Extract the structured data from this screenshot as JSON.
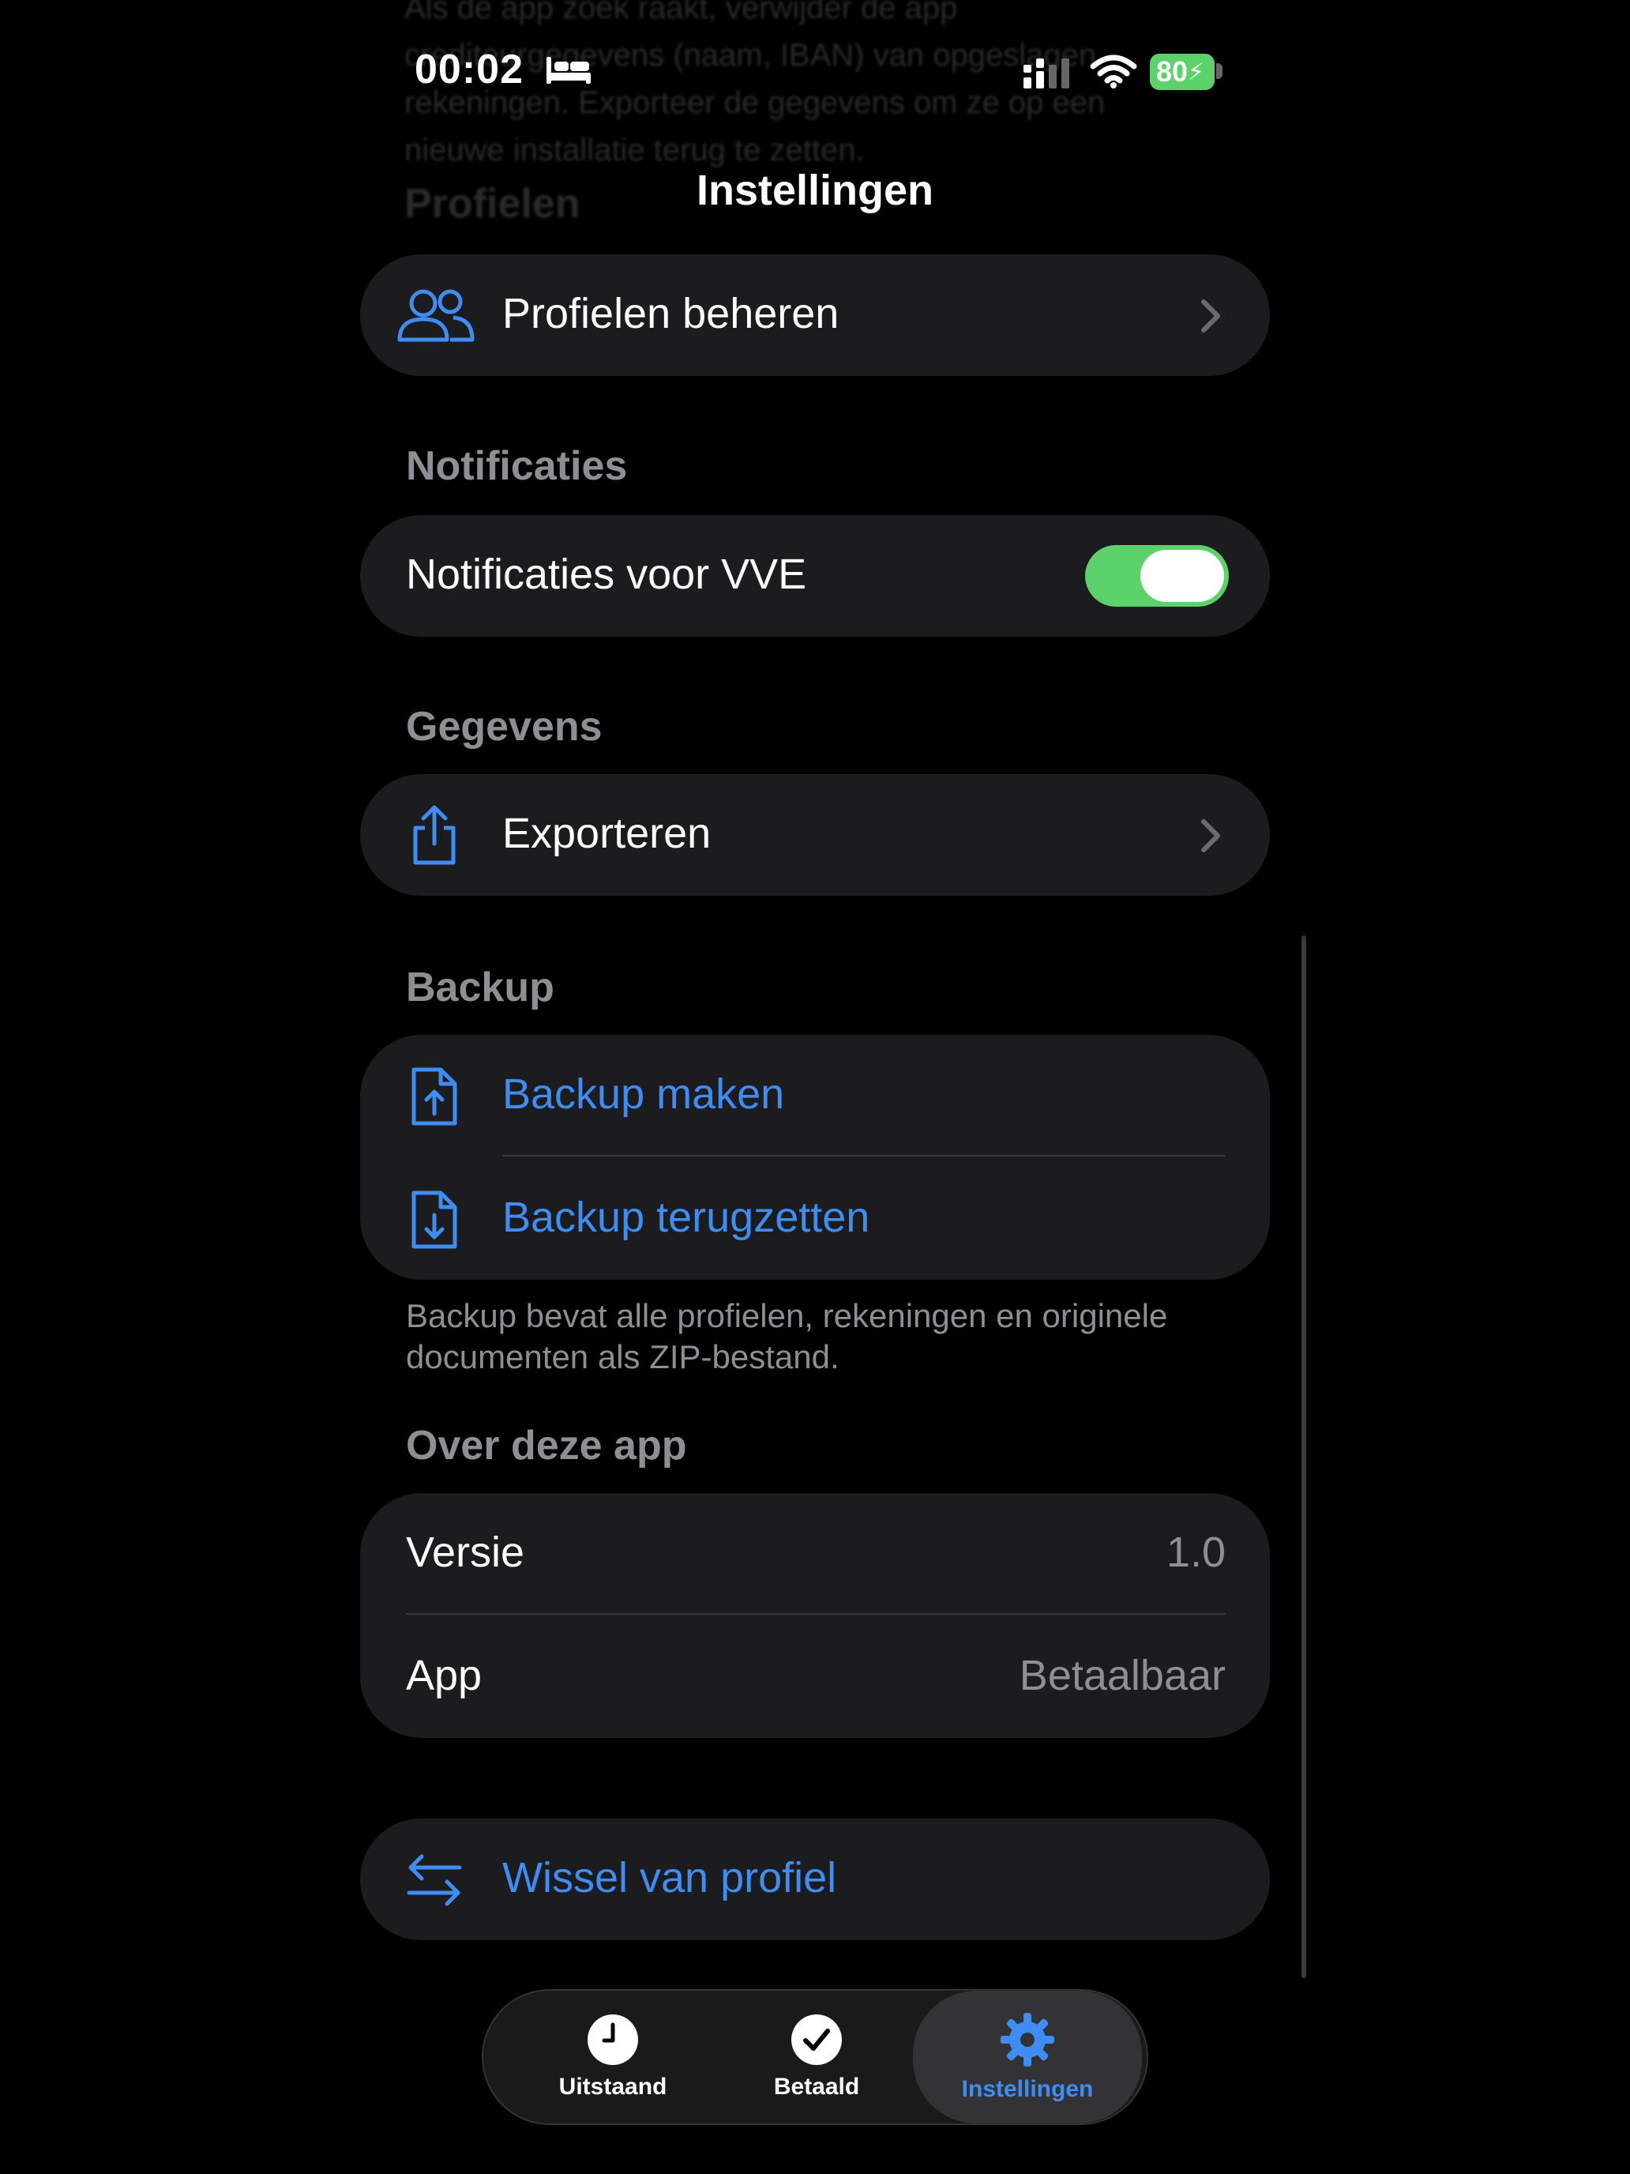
{
  "status_bar": {
    "time": "00:02",
    "battery": "80"
  },
  "background_text": {
    "lines": [
      "Als de app zoek raakt, verwijder de app",
      "crediteurgegevens (naam, IBAN) van opgeslagen",
      "rekeningen. Exporteer de gegevens om ze op een",
      "nieuwe installatie terug te zetten."
    ],
    "heading": "Profielen"
  },
  "header": {
    "title": "Instellingen"
  },
  "profiles": {
    "manage_label": "Profielen beheren"
  },
  "notifications": {
    "section_title": "Notificaties",
    "toggle_label": "Notificaties voor VVE",
    "toggle_on": true
  },
  "data": {
    "section_title": "Gegevens",
    "export_label": "Exporteren"
  },
  "backup": {
    "section_title": "Backup",
    "make_label": "Backup maken",
    "restore_label": "Backup terugzetten",
    "footnote": "Backup bevat alle profielen, rekeningen en originele documenten als ZIP-bestand."
  },
  "about": {
    "section_title": "Over deze app",
    "version_label": "Versie",
    "version_value": "1.0",
    "app_label": "App",
    "app_value": "Betaalbaar"
  },
  "switch_profile": {
    "label": "Wissel van profiel"
  },
  "tabs": [
    {
      "label": "Uitstaand",
      "icon": "clock-icon",
      "active": false
    },
    {
      "label": "Betaald",
      "icon": "checkmark-circle-icon",
      "active": false
    },
    {
      "label": "Instellingen",
      "icon": "gear-icon",
      "active": true
    }
  ],
  "colors": {
    "accent": "#3d8df5",
    "toggle_on": "#5bd26a",
    "card": "#1c1c1e",
    "secondary_text": "#8e8e93"
  }
}
